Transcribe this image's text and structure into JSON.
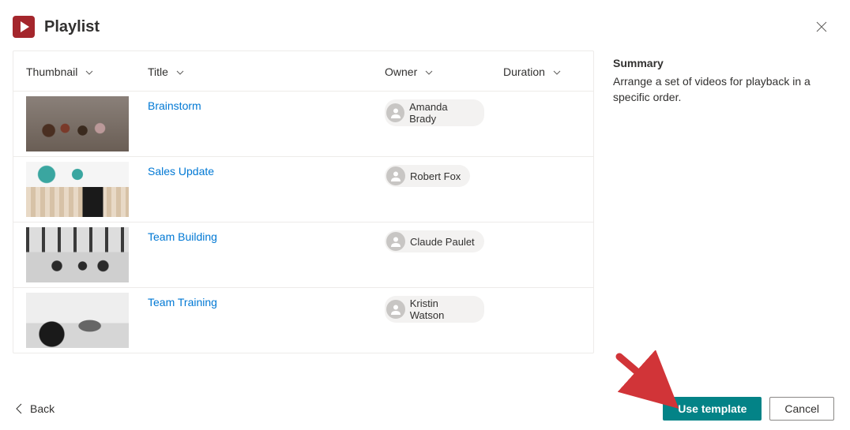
{
  "header": {
    "title": "Playlist"
  },
  "summary": {
    "heading": "Summary",
    "text": "Arrange a set of videos for playback in a specific order."
  },
  "table": {
    "columns": {
      "thumbnail": "Thumbnail",
      "title": "Title",
      "owner": "Owner",
      "duration": "Duration"
    },
    "rows": [
      {
        "title": "Brainstorm",
        "owner": "Amanda Brady"
      },
      {
        "title": "Sales Update",
        "owner": "Robert Fox"
      },
      {
        "title": "Team Building",
        "owner": "Claude Paulet"
      },
      {
        "title": "Team Training",
        "owner": "Kristin Watson"
      }
    ]
  },
  "footer": {
    "back": "Back",
    "use_template": "Use template",
    "cancel": "Cancel"
  },
  "colors": {
    "accent": "#a4262c",
    "primary_button": "#038387",
    "link": "#0078d4"
  }
}
